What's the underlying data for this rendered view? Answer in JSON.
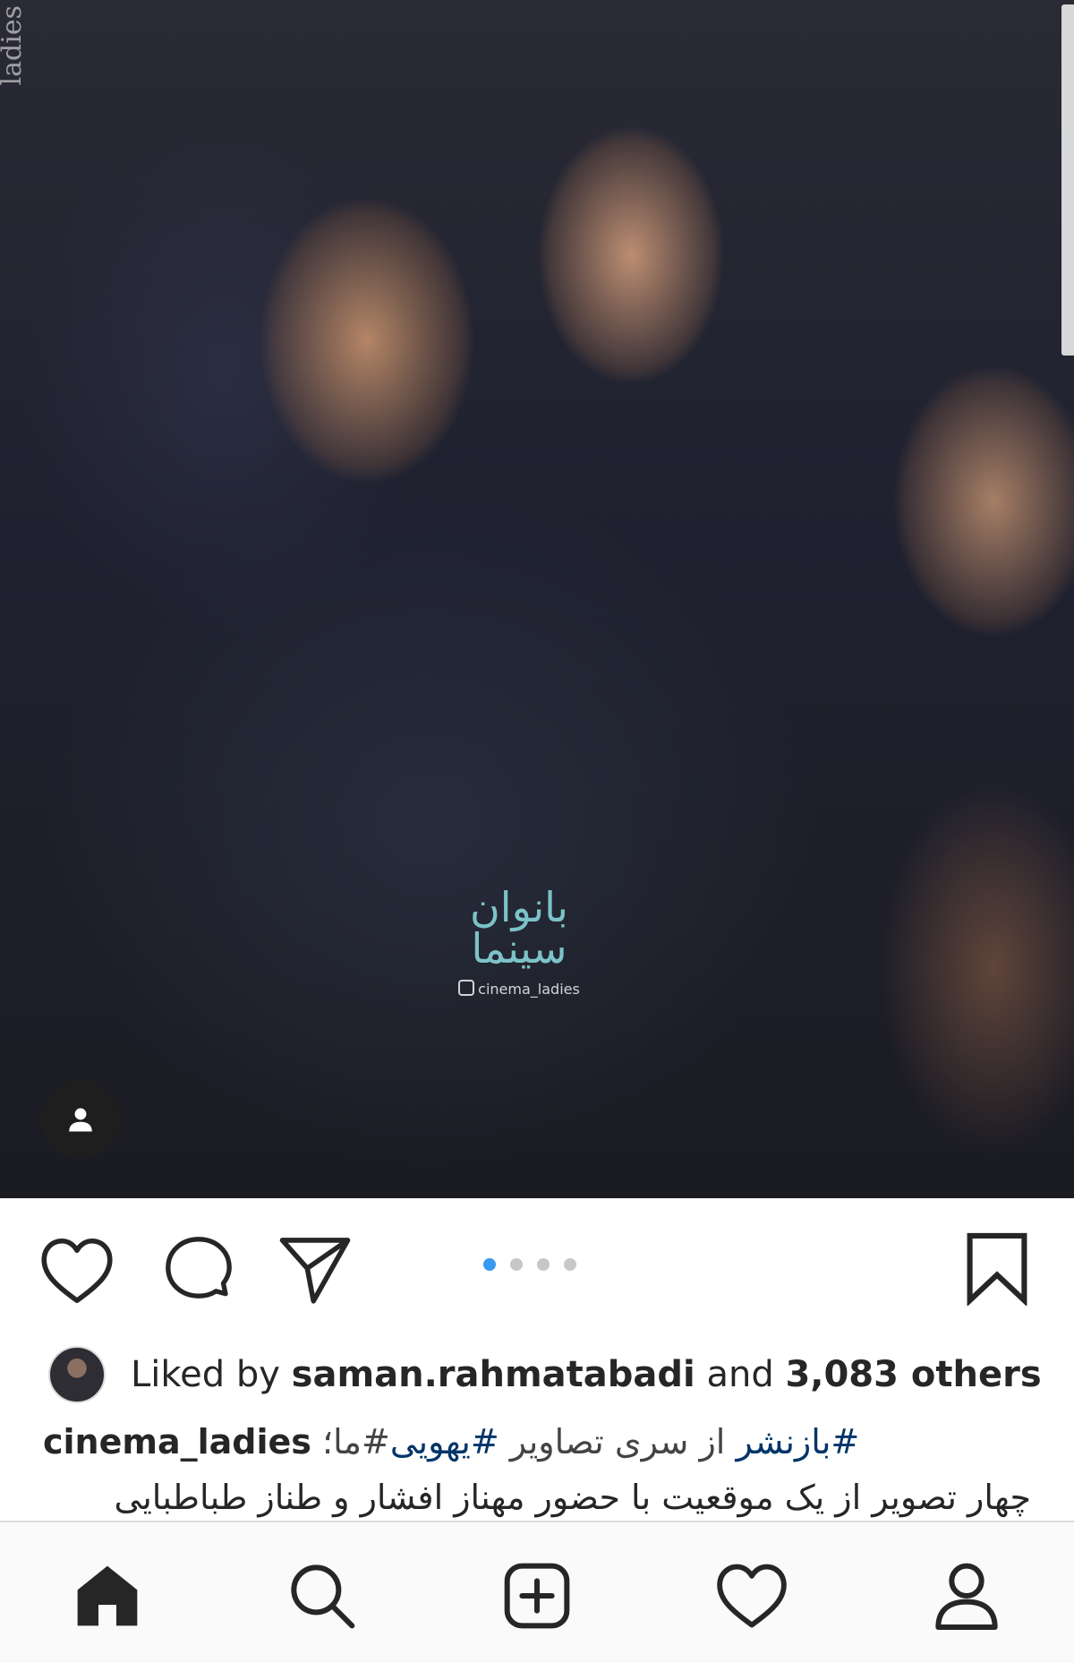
{
  "post": {
    "image_watermark_side": "ladies",
    "image_watermark_logo": "بانوان سینما",
    "image_watermark_handle": "cinema_ladies",
    "carousel_count": 4,
    "carousel_active_index": 0
  },
  "likes": {
    "prefix": "Liked by",
    "user": "saman.rahmatabadi",
    "conjunction": "and",
    "others": "3,083 others"
  },
  "caption": {
    "username": "cinema_ladies",
    "line1_text": "#ما؛ ",
    "line1_hashtag1": "#یهویی",
    "line1_mid": " از سری تصاویر ",
    "line1_hashtag2": "#بازنشر",
    "line2": "چهار تصویر از یک موقعیت با حضور مهناز افشار و طناز طباطبایی"
  },
  "colors": {
    "accent": "#3897f0",
    "hashtag": "#003569",
    "text": "#262626",
    "divider": "#dbdbdb"
  },
  "icons": {
    "like": "heart-icon",
    "comment": "comment-icon",
    "share": "send-icon",
    "save": "bookmark-icon",
    "tag": "person-tag-icon",
    "nav": [
      "home-icon",
      "search-icon",
      "add-post-icon",
      "activity-heart-icon",
      "profile-icon"
    ]
  }
}
